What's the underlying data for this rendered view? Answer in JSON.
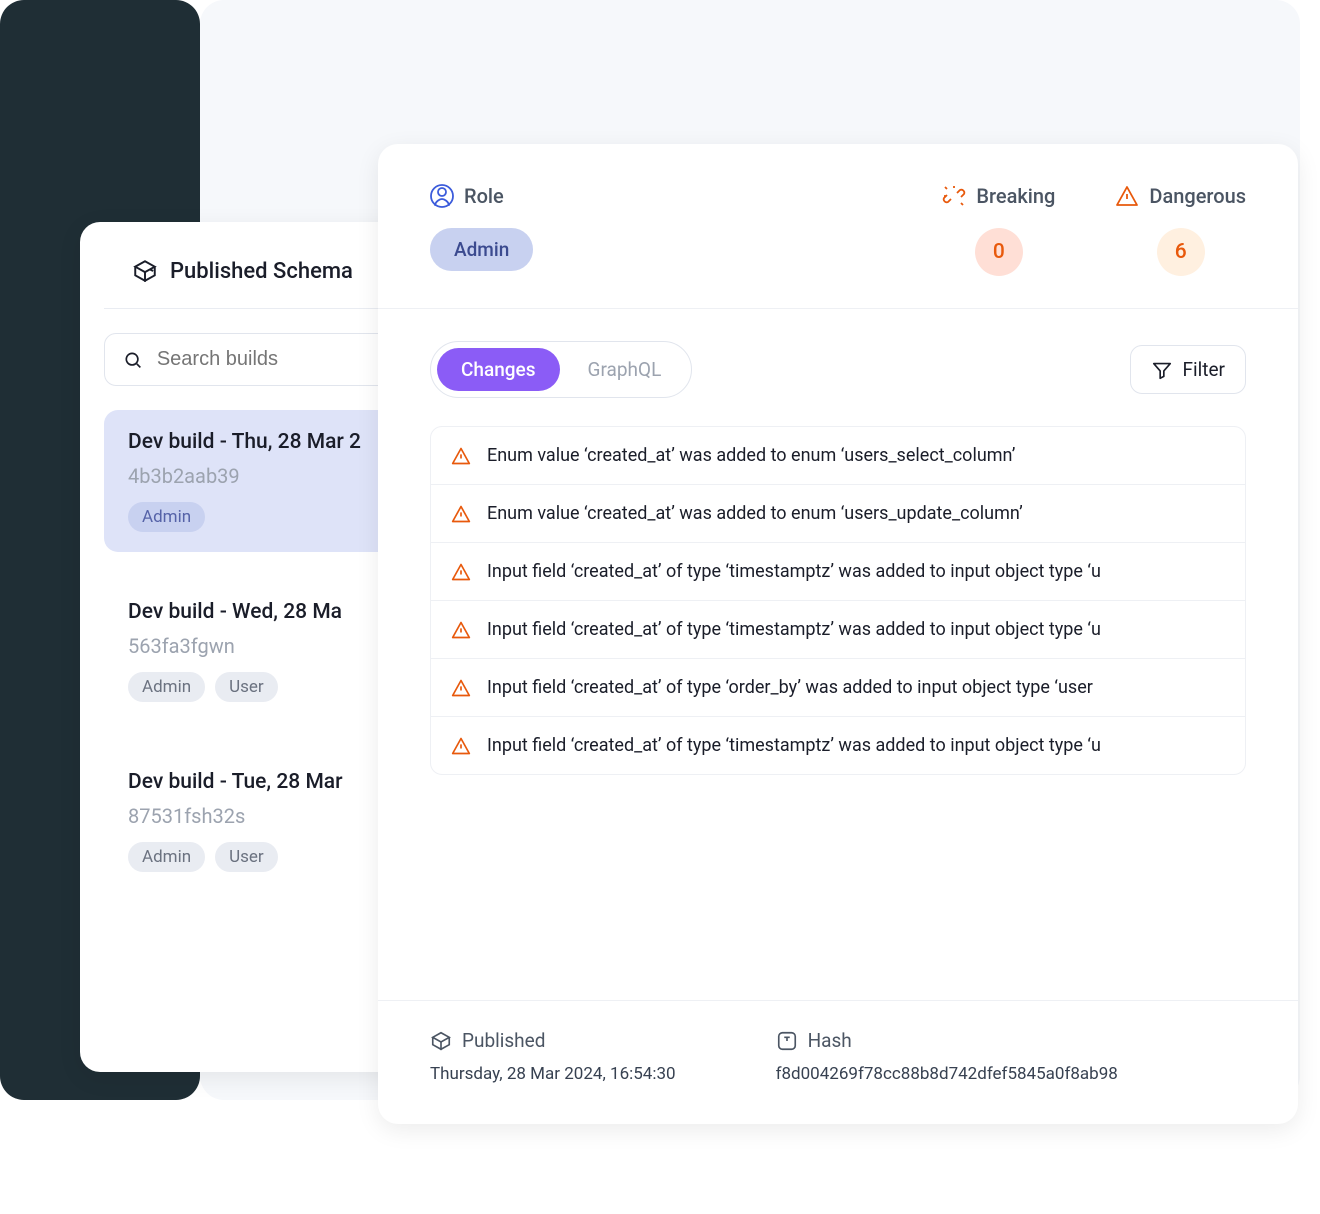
{
  "sidebar": {
    "title": "Published Schema",
    "search_placeholder": "Search builds",
    "builds": [
      {
        "title": "Dev build - Thu, 28 Mar 2",
        "hash": "4b3b2aab39",
        "tags": [
          "Admin"
        ],
        "selected": true
      },
      {
        "title": "Dev build - Wed, 28 Ma",
        "hash": "563fa3fgwn",
        "tags": [
          "Admin",
          "User"
        ],
        "selected": false
      },
      {
        "title": "Dev build - Tue, 28 Mar",
        "hash": "87531fsh32s",
        "tags": [
          "Admin",
          "User"
        ],
        "selected": false
      }
    ]
  },
  "stats": {
    "role_label": "Role",
    "role_value": "Admin",
    "breaking_label": "Breaking",
    "breaking_count": "0",
    "dangerous_label": "Dangerous",
    "dangerous_count": "6"
  },
  "tabs": {
    "changes": "Changes",
    "graphql": "GraphQL"
  },
  "filter_label": "Filter",
  "changes": [
    "Enum value ‘created_at’ was added to enum ‘users_select_column’",
    "Enum value ‘created_at’ was added to enum ‘users_update_column’",
    "Input field ‘created_at’ of type ‘timestamptz’ was added to input object type ‘u",
    "Input field ‘created_at’ of type ‘timestamptz’ was added to input object type ‘u",
    "Input field ‘created_at’ of type ‘order_by’ was added to input object type ‘user",
    "Input field ‘created_at’ of type ‘timestamptz’ was added to input object type ‘u"
  ],
  "footer": {
    "published_label": "Published",
    "published_value": "Thursday, 28 Mar 2024, 16:54:30",
    "hash_label": "Hash",
    "hash_value": "f8d004269f78cc88b8d742dfef5845a0f8ab98"
  }
}
